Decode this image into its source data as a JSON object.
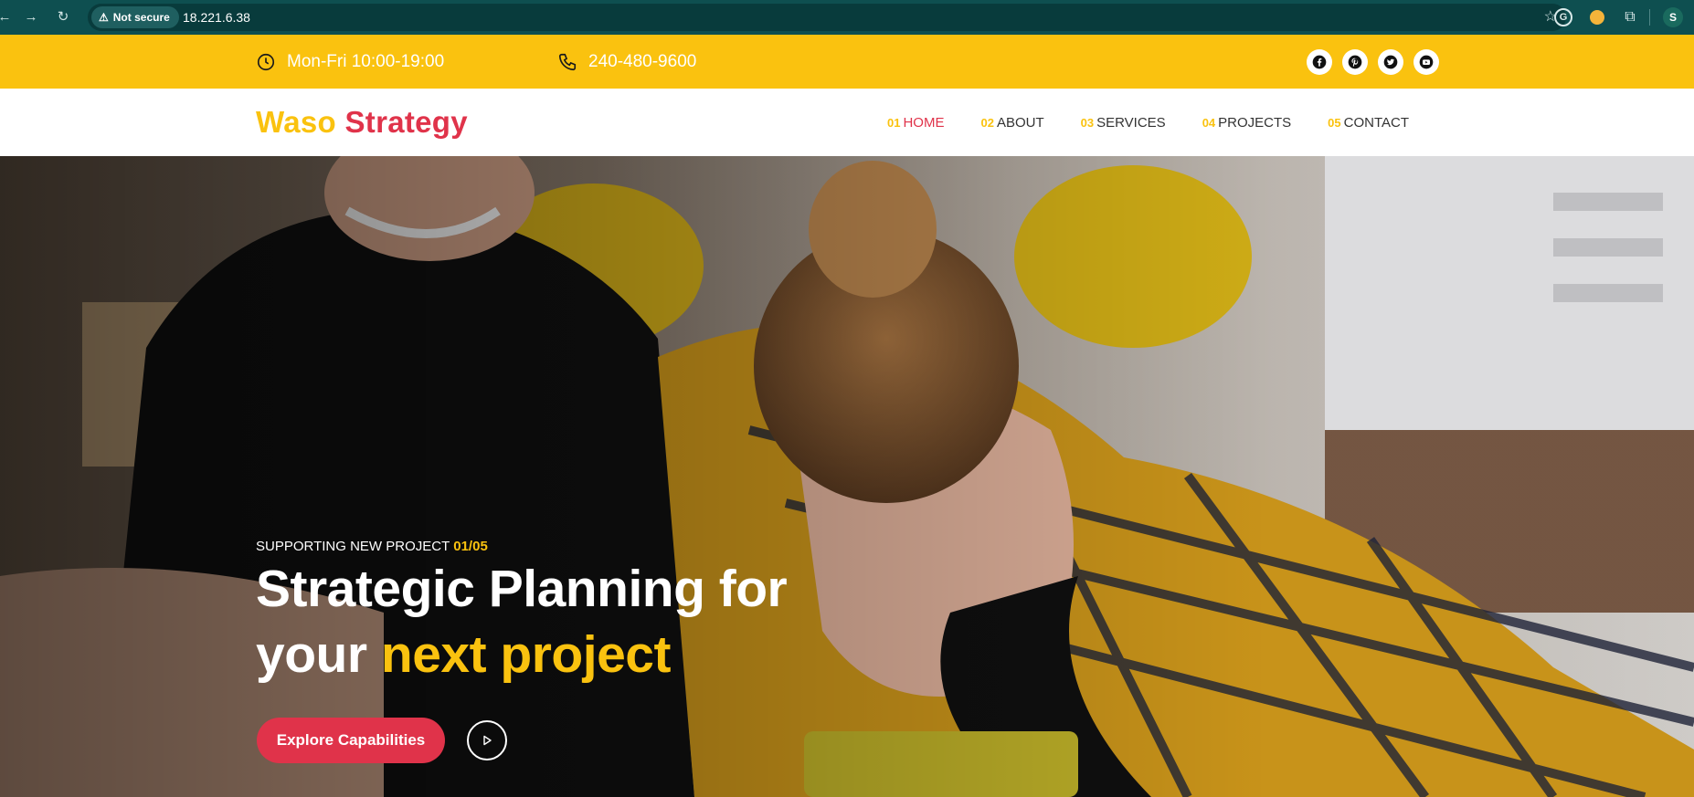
{
  "browser": {
    "secure_label": "Not secure",
    "url": "18.221.6.38",
    "profile_initial": "S",
    "extension_g": "G"
  },
  "topbar": {
    "hours": "Mon-Fri 10:00-19:00",
    "phone": "240-480-9600",
    "socials": [
      "facebook-icon",
      "pinterest-icon",
      "twitter-icon",
      "youtube-icon"
    ]
  },
  "header": {
    "logo_part1": "Waso",
    "logo_part2": "Strategy",
    "menu": [
      {
        "num": "01",
        "label": "HOME",
        "active": true
      },
      {
        "num": "02",
        "label": "ABOUT",
        "active": false
      },
      {
        "num": "03",
        "label": "SERVICES",
        "active": false
      },
      {
        "num": "04",
        "label": "PROJECTS",
        "active": false
      },
      {
        "num": "05",
        "label": "CONTACT",
        "active": false
      }
    ]
  },
  "hero": {
    "eyebrow": "SUPPORTING NEW PROJECT",
    "counter": "01/05",
    "headline_line1": "Strategic Planning for",
    "headline_line2_plain": "your",
    "headline_line2_highlight": "next project",
    "cta_label": "Explore Capabilities"
  },
  "colors": {
    "chrome": "#0e4f50",
    "accent_yellow": "#fac20f",
    "accent_red": "#e0334a"
  }
}
